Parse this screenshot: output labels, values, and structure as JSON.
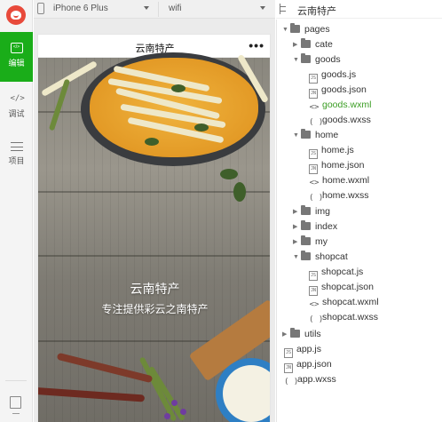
{
  "leftnav": {
    "edit": "编辑",
    "debug": "调试",
    "project": "项目"
  },
  "toolbar": {
    "device": "iPhone 6 Plus",
    "network": "wifi"
  },
  "phone": {
    "nav_title": "云南特产",
    "more": "•••",
    "hero_title": "云南特产",
    "hero_subtitle": "专注提供彩云之南特产"
  },
  "tree": {
    "title": "云南特产",
    "items": {
      "pages": "pages",
      "cate": "cate",
      "goods": "goods",
      "goods_js": "goods.js",
      "goods_json": "goods.json",
      "goods_wxml": "goods.wxml",
      "goods_wxss": "goods.wxss",
      "home": "home",
      "home_js": "home.js",
      "home_json": "home.json",
      "home_wxml": "home.wxml",
      "home_wxss": "home.wxss",
      "img": "img",
      "index": "index",
      "my": "my",
      "shopcat": "shopcat",
      "shopcat_js": "shopcat.js",
      "shopcat_json": "shopcat.json",
      "shopcat_wxml": "shopcat.wxml",
      "shopcat_wxss": "shopcat.wxss",
      "utils": "utils",
      "app_js": "app.js",
      "app_json": "app.json",
      "app_wxss": "app.wxss"
    }
  },
  "colors": {
    "accent": "#1aad19",
    "selected_file": "#3a9d23"
  }
}
